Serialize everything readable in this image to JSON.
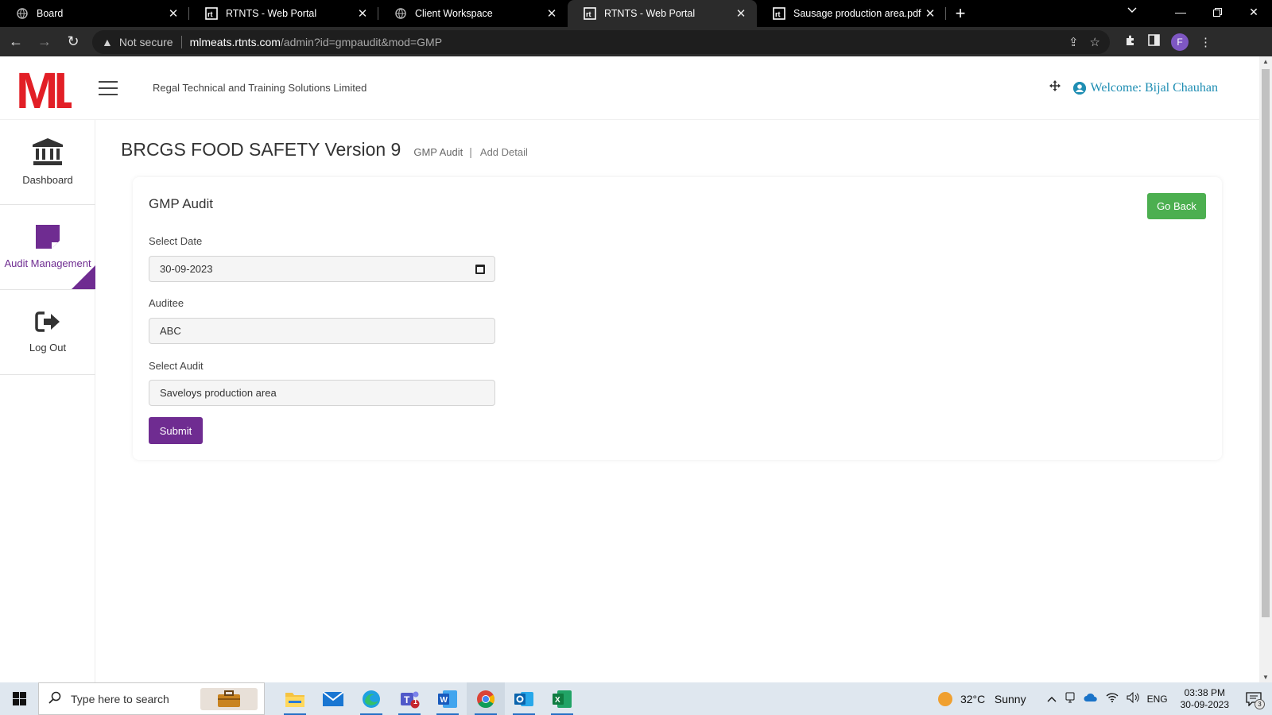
{
  "browser": {
    "tabs": [
      {
        "title": "Board",
        "favicon": "globe-icon",
        "active": false
      },
      {
        "title": "RTNTS - Web Portal",
        "favicon": "rt-logo-icon",
        "active": false
      },
      {
        "title": "Client Workspace",
        "favicon": "globe-icon",
        "active": false
      },
      {
        "title": "RTNTS - Web Portal",
        "favicon": "rt-logo-icon",
        "active": true
      },
      {
        "title": "Sausage production area.pdf",
        "favicon": "rt-logo-icon",
        "active": false
      }
    ],
    "security_label": "Not secure",
    "url_host": "mlmeats.rtnts.com",
    "url_path": "/admin?id=gmpaudit&mod=GMP",
    "profile_initial": "F"
  },
  "header": {
    "logo_text": "ML",
    "company": "Regal Technical and Training Solutions Limited",
    "welcome": "Welcome: Bijal Chauhan"
  },
  "sidebar": {
    "items": [
      {
        "label": "Dashboard",
        "icon": "bank-icon"
      },
      {
        "label": "Audit Management",
        "icon": "note-icon",
        "active": true
      },
      {
        "label": "Log Out",
        "icon": "sign-out-icon"
      }
    ]
  },
  "page": {
    "title": "BRCGS FOOD SAFETY Version 9",
    "breadcrumb_1": "GMP Audit",
    "breadcrumb_sep": "|",
    "breadcrumb_2": "Add Detail"
  },
  "form": {
    "title": "GMP Audit",
    "go_back": "Go Back",
    "date_label": "Select Date",
    "date_value": "30-09-2023",
    "auditee_label": "Auditee",
    "auditee_value": "ABC",
    "audit_label": "Select Audit",
    "audit_value": "Saveloys production area",
    "submit": "Submit"
  },
  "taskbar": {
    "search_placeholder": "Type here to search",
    "weather_temp": "32°C",
    "weather_desc": "Sunny",
    "language": "ENG",
    "time": "03:38 PM",
    "date": "30-09-2023",
    "notif_count": "3",
    "teams_badge": "1"
  },
  "colors": {
    "brand_purple": "#6f2c91",
    "go_back_green": "#4caf50",
    "welcome_blue": "#1f8eb3",
    "logo_red": "#e21f26"
  }
}
